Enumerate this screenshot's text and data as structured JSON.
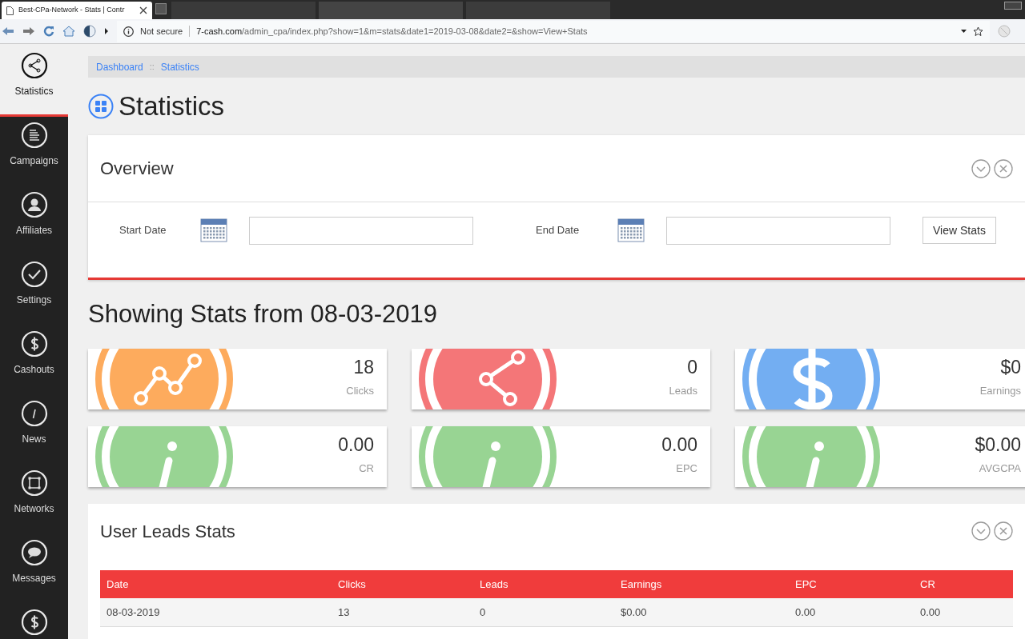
{
  "browser": {
    "tab_title": "Best-CPa-Network - Stats | Contr",
    "security": "Not secure",
    "url_host": "7-cash.com",
    "url_path": "/admin_cpa/index.php?show=1&m=stats&date1=2019-03-08&date2=&show=View+Stats"
  },
  "sidebar": {
    "items": [
      {
        "label": "Statistics",
        "kind": "share",
        "selected": true
      },
      {
        "label": "Campaigns",
        "kind": "list",
        "selected": false
      },
      {
        "label": "Affiliates",
        "kind": "user",
        "selected": false
      },
      {
        "label": "Settings",
        "kind": "check",
        "selected": false
      },
      {
        "label": "Cashouts",
        "kind": "dollar",
        "selected": false
      },
      {
        "label": "News",
        "kind": "info",
        "selected": false
      },
      {
        "label": "Networks",
        "kind": "square",
        "selected": false
      },
      {
        "label": "Messages",
        "kind": "chat",
        "selected": false
      },
      {
        "kind": "dollar",
        "selected": false
      }
    ]
  },
  "breadcrumb": [
    "Dashboard",
    "::",
    "Statistics"
  ],
  "page_title": "Statistics",
  "overview": {
    "title": "Overview",
    "start_label": "Start Date",
    "end_label": "End Date",
    "button": "View Stats"
  },
  "showing_heading": "Showing Stats from 08-03-2019",
  "stat_cards": [
    {
      "value": "18",
      "label": "Clicks",
      "kind": "chart",
      "color": "#fdab5d"
    },
    {
      "value": "0",
      "label": "Leads",
      "kind": "share",
      "color": "#f47678"
    },
    {
      "value": "$0",
      "label": "Earnings",
      "kind": "dollar",
      "color": "#73aef2"
    },
    {
      "value": "0.00",
      "label": "CR",
      "kind": "info",
      "color": "#98d493"
    },
    {
      "value": "0.00",
      "label": "EPC",
      "kind": "info",
      "color": "#98d493"
    },
    {
      "value": "$0.00",
      "label": "AVGCPA",
      "kind": "info",
      "color": "#98d493"
    }
  ],
  "leads": {
    "title": "User Leads Stats",
    "columns": [
      "Date",
      "Clicks",
      "Leads",
      "Earnings",
      "EPC",
      "CR"
    ],
    "rows": [
      [
        "08-03-2019",
        "13",
        "0",
        "$0.00",
        "0.00",
        "0.00"
      ]
    ]
  }
}
